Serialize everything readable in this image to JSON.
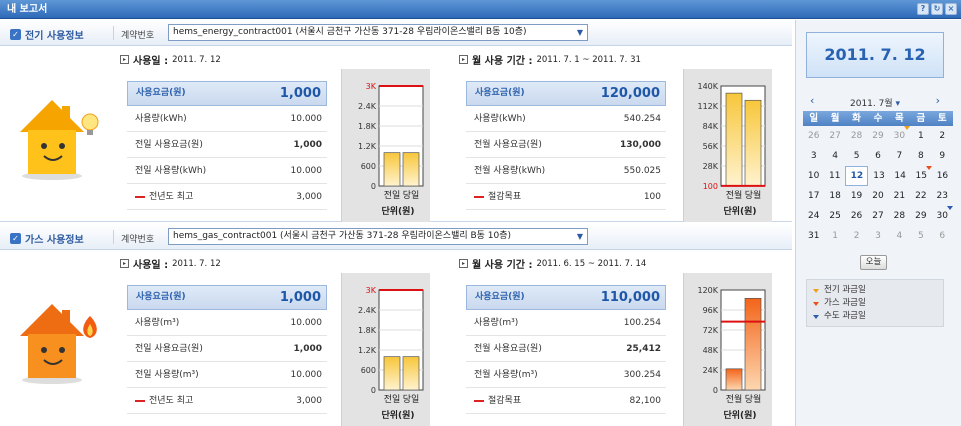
{
  "title": "내 보고서",
  "titlebar_icons": [
    "help-icon",
    "refresh-icon",
    "close-icon"
  ],
  "electric": {
    "section_title": "전기 사용정보",
    "contract_label": "계약번호",
    "contract_value": "hems_energy_contract001 (서울시 금천구 가산동 371-28 우림라이온스밸리 B동 10층)",
    "daily": {
      "title": "사용일 :",
      "date": "2011. 7. 12",
      "rows": [
        {
          "label": "사용요금(원)",
          "value": "1,000"
        },
        {
          "label": "사용량(kWh)",
          "value": "10.000"
        },
        {
          "label": "전일 사용요금(원)",
          "value": "1,000"
        },
        {
          "label": "전일 사용량(kWh)",
          "value": "10.000"
        },
        {
          "label": "전년도 최고",
          "value": "3,000"
        }
      ],
      "chart": {
        "ticks": [
          "3K",
          "2.4K",
          "1.8K",
          "1.2K",
          "600",
          "0"
        ],
        "bars": [
          1000,
          1000
        ],
        "max": 3000,
        "ref": 3000,
        "ref_label": "3K",
        "cats": [
          "전일",
          "당일"
        ],
        "unit": "단위(원)"
      }
    },
    "monthly": {
      "title": "월 사용 기간 :",
      "date": "2011. 7. 1 ~ 2011. 7. 31",
      "rows": [
        {
          "label": "사용요금(원)",
          "value": "120,000"
        },
        {
          "label": "사용량(kWh)",
          "value": "540.254"
        },
        {
          "label": "전월 사용요금(원)",
          "value": "130,000"
        },
        {
          "label": "전월 사용량(kWh)",
          "value": "550.025"
        },
        {
          "label": "절감목표",
          "value": "100"
        }
      ],
      "chart": {
        "ticks": [
          "140K",
          "112K",
          "84K",
          "56K",
          "28K",
          "100"
        ],
        "bars": [
          130000,
          120000
        ],
        "max": 140000,
        "ref": 100,
        "ref_label": "100",
        "cats": [
          "전월",
          "당월"
        ],
        "unit": "단위(원)"
      }
    }
  },
  "gas": {
    "section_title": "가스 사용정보",
    "contract_label": "계약번호",
    "contract_value": "hems_gas_contract001 (서울시 금천구 가산동 371-28 우림라이온스밸리 B동 10층)",
    "daily": {
      "title": "사용일 :",
      "date": "2011. 7. 12",
      "rows": [
        {
          "label": "사용요금(원)",
          "value": "1,000"
        },
        {
          "label": "사용량(m³)",
          "value": "10.000"
        },
        {
          "label": "전일 사용요금(원)",
          "value": "1,000"
        },
        {
          "label": "전일 사용량(m³)",
          "value": "10.000"
        },
        {
          "label": "전년도 최고",
          "value": "3,000"
        }
      ],
      "chart": {
        "ticks": [
          "3K",
          "2.4K",
          "1.8K",
          "1.2K",
          "600",
          "0"
        ],
        "bars": [
          1000,
          1000
        ],
        "max": 3000,
        "ref": 3000,
        "ref_label": "3K",
        "cats": [
          "전일",
          "당일"
        ],
        "unit": "단위(원)"
      }
    },
    "monthly": {
      "title": "월 사용 기간 :",
      "date": "2011. 6. 15 ~ 2011. 7. 14",
      "rows": [
        {
          "label": "사용요금(원)",
          "value": "110,000"
        },
        {
          "label": "사용량(m³)",
          "value": "100.254"
        },
        {
          "label": "전월 사용요금(원)",
          "value": "25,412"
        },
        {
          "label": "전월 사용량(m³)",
          "value": "300.254"
        },
        {
          "label": "절감목표",
          "value": "82,100"
        }
      ],
      "chart": {
        "ticks": [
          "120K",
          "96K",
          "72K",
          "48K",
          "24K",
          "0"
        ],
        "bars": [
          25412,
          110000
        ],
        "max": 120000,
        "ref": 82100,
        "ref_label": "82.1K",
        "cats": [
          "전월",
          "당월"
        ],
        "unit": "단위(원)"
      }
    }
  },
  "calendar": {
    "selected_date": "2011. 7. 12",
    "month_label": "2011. 7월",
    "weekdays": [
      "일",
      "월",
      "화",
      "수",
      "목",
      "금",
      "토"
    ],
    "weeks": [
      [
        "26",
        "27",
        "28",
        "29",
        "30",
        "1",
        "2"
      ],
      [
        "3",
        "4",
        "5",
        "6",
        "7",
        "8",
        "9"
      ],
      [
        "10",
        "11",
        "12",
        "13",
        "14",
        "15",
        "16"
      ],
      [
        "17",
        "18",
        "19",
        "20",
        "21",
        "22",
        "23"
      ],
      [
        "24",
        "25",
        "26",
        "27",
        "28",
        "29",
        "30"
      ],
      [
        "31",
        "1",
        "2",
        "3",
        "4",
        "5",
        "6"
      ]
    ],
    "today_button": "오늘",
    "legend": [
      {
        "label": "전기 과금일",
        "color": "#f2a01c"
      },
      {
        "label": "가스 과금일",
        "color": "#e8501a"
      },
      {
        "label": "수도 과금일",
        "color": "#2a5db0"
      }
    ]
  }
}
